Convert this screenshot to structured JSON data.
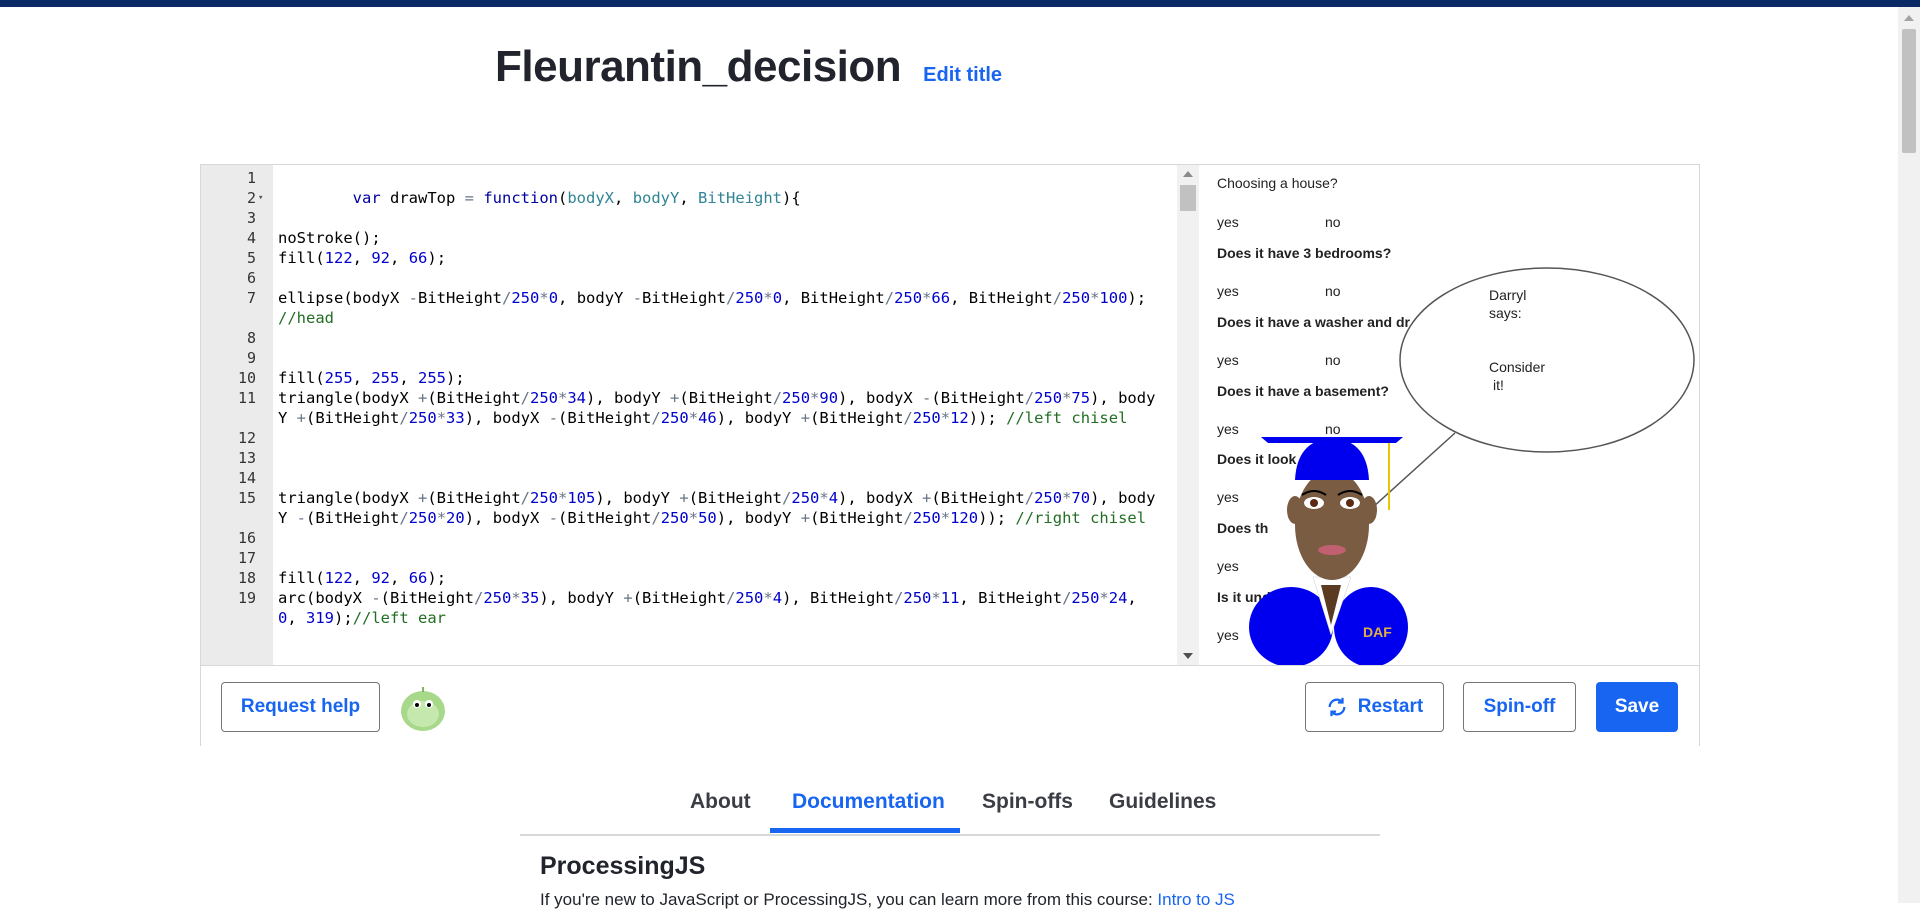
{
  "page": {
    "title": "Fleurantin_decision",
    "edit_title_label": "Edit title"
  },
  "editor": {
    "lines": [
      {
        "n": "1",
        "html": ""
      },
      {
        "n": "2",
        "fold": true,
        "html": "        <span class='kw'>var</span> drawTop <span class='op'>=</span> <span class='kw'>function</span>(<span class='prm'>bodyX</span>, <span class='prm'>bodyY</span>, <span class='prm'>BitHeight</span>){"
      },
      {
        "n": "3",
        "html": ""
      },
      {
        "n": "4",
        "html": "noStroke();"
      },
      {
        "n": "5",
        "html": "fill(<span class='num'>122</span>, <span class='num'>92</span>, <span class='num'>66</span>);"
      },
      {
        "n": "6",
        "html": ""
      },
      {
        "n": "7",
        "html": "ellipse(bodyX <span class='op'>-</span>BitHeight<span class='op'>/</span><span class='num'>250</span><span class='op'>*</span><span class='num'>0</span>, bodyY <span class='op'>-</span>BitHeight<span class='op'>/</span><span class='num'>250</span><span class='op'>*</span><span class='num'>0</span>, BitHeight<span class='op'>/</span><span class='num'>250</span><span class='op'>*</span><span class='num'>66</span>, BitHeight<span class='op'>/</span><span class='num'>250</span><span class='op'>*</span><span class='num'>100</span>); <span class='cmt'>//head</span>"
      },
      {
        "n": "8",
        "html": ""
      },
      {
        "n": "9",
        "html": ""
      },
      {
        "n": "10",
        "html": "fill(<span class='num'>255</span>, <span class='num'>255</span>, <span class='num'>255</span>);"
      },
      {
        "n": "11",
        "html": "triangle(bodyX <span class='op'>+</span>(BitHeight<span class='op'>/</span><span class='num'>250</span><span class='op'>*</span><span class='num'>34</span>), bodyY <span class='op'>+</span>(BitHeight<span class='op'>/</span><span class='num'>250</span><span class='op'>*</span><span class='num'>90</span>), bodyX <span class='op'>-</span>(BitHeight<span class='op'>/</span><span class='num'>250</span><span class='op'>*</span><span class='num'>75</span>), bodyY <span class='op'>+</span>(BitHeight<span class='op'>/</span><span class='num'>250</span><span class='op'>*</span><span class='num'>33</span>), bodyX <span class='op'>-</span>(BitHeight<span class='op'>/</span><span class='num'>250</span><span class='op'>*</span><span class='num'>46</span>), bodyY <span class='op'>+</span>(BitHeight<span class='op'>/</span><span class='num'>250</span><span class='op'>*</span><span class='num'>12</span>)); <span class='cmt'>//left chisel</span>"
      },
      {
        "n": "12",
        "html": ""
      },
      {
        "n": "13",
        "html": ""
      },
      {
        "n": "14",
        "html": ""
      },
      {
        "n": "15",
        "html": "triangle(bodyX <span class='op'>+</span>(BitHeight<span class='op'>/</span><span class='num'>250</span><span class='op'>*</span><span class='num'>105</span>), bodyY <span class='op'>+</span>(BitHeight<span class='op'>/</span><span class='num'>250</span><span class='op'>*</span><span class='num'>4</span>), bodyX <span class='op'>+</span>(BitHeight<span class='op'>/</span><span class='num'>250</span><span class='op'>*</span><span class='num'>70</span>), bodyY <span class='op'>-</span>(BitHeight<span class='op'>/</span><span class='num'>250</span><span class='op'>*</span><span class='num'>20</span>), bodyX <span class='op'>-</span>(BitHeight<span class='op'>/</span><span class='num'>250</span><span class='op'>*</span><span class='num'>50</span>), bodyY <span class='op'>+</span>(BitHeight<span class='op'>/</span><span class='num'>250</span><span class='op'>*</span><span class='num'>120</span>)); <span class='cmt'>//right chisel</span>"
      },
      {
        "n": "16",
        "html": ""
      },
      {
        "n": "17",
        "html": ""
      },
      {
        "n": "18",
        "html": "fill(<span class='num'>122</span>, <span class='num'>92</span>, <span class='num'>66</span>);"
      },
      {
        "n": "19",
        "html": "arc(bodyX <span class='op'>-</span>(BitHeight<span class='op'>/</span><span class='num'>250</span><span class='op'>*</span><span class='num'>35</span>), bodyY <span class='op'>+</span>(BitHeight<span class='op'>/</span><span class='num'>250</span><span class='op'>*</span><span class='num'>4</span>), BitHeight<span class='op'>/</span><span class='num'>250</span><span class='op'>*</span><span class='num'>11</span>, BitHeight<span class='op'>/</span><span class='num'>250</span><span class='op'>*</span><span class='num'>24</span>, <span class='num'>0</span>, <span class='num'>319</span>);<span class='cmt'>//left ear</span>"
      }
    ]
  },
  "canvas": {
    "choosing": "Choosing a house?",
    "yes": "yes",
    "no": "no",
    "q1": "Does it have 3 bedrooms?",
    "q2": "Does it have a washer and dr",
    "q3": "Does it have a basement?",
    "q4": "Does it look",
    "q5": "Does th",
    "q6": "Is it under",
    "bubble_line1": "Darryl",
    "bubble_line2": "says:",
    "bubble_line3": "Consider",
    "bubble_line4": "it!",
    "badge": "DAF"
  },
  "footer": {
    "request_help": "Request help",
    "restart": "Restart",
    "spinoff": "Spin-off",
    "save": "Save"
  },
  "tabs": [
    "About",
    "Documentation",
    "Spin-offs",
    "Guidelines"
  ],
  "docs": {
    "title": "ProcessingJS",
    "text": "If you're new to JavaScript or ProcessingJS, you can learn more from this course: ",
    "link": "Intro to JS"
  },
  "colors": {
    "accent": "#1865f2",
    "topbar": "#0a2a66"
  }
}
